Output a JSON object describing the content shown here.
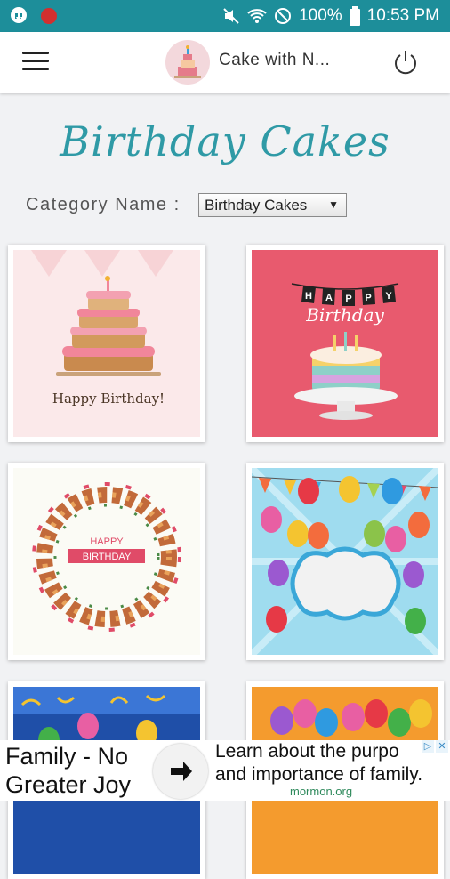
{
  "status_bar": {
    "battery_percent": "100%",
    "time": "10:53 PM"
  },
  "app_bar": {
    "title": "Cake with N..."
  },
  "page": {
    "heading": "Birthday Cakes",
    "category_label": "Category Name :",
    "category_selected": "Birthday Cakes"
  },
  "cards": [
    {
      "caption": "Happy Birthday!"
    },
    {
      "banner": [
        "H",
        "A",
        "P",
        "P",
        "Y"
      ],
      "script": "Birthday"
    },
    {
      "wreath_top": "HAPPY",
      "wreath_bottom": "BIRTHDAY"
    },
    {},
    {},
    {}
  ],
  "ad": {
    "left_text_line1": "Family - No",
    "left_text_line2": "Greater Joy",
    "right_text_line1": "Learn about the purpo",
    "right_text_line2": "and importance of family.",
    "source": "mormon.org"
  },
  "colors": {
    "status_bar": "#1d8e9a",
    "heading": "#2f9aa6",
    "card2_background": "#e85a6e"
  }
}
